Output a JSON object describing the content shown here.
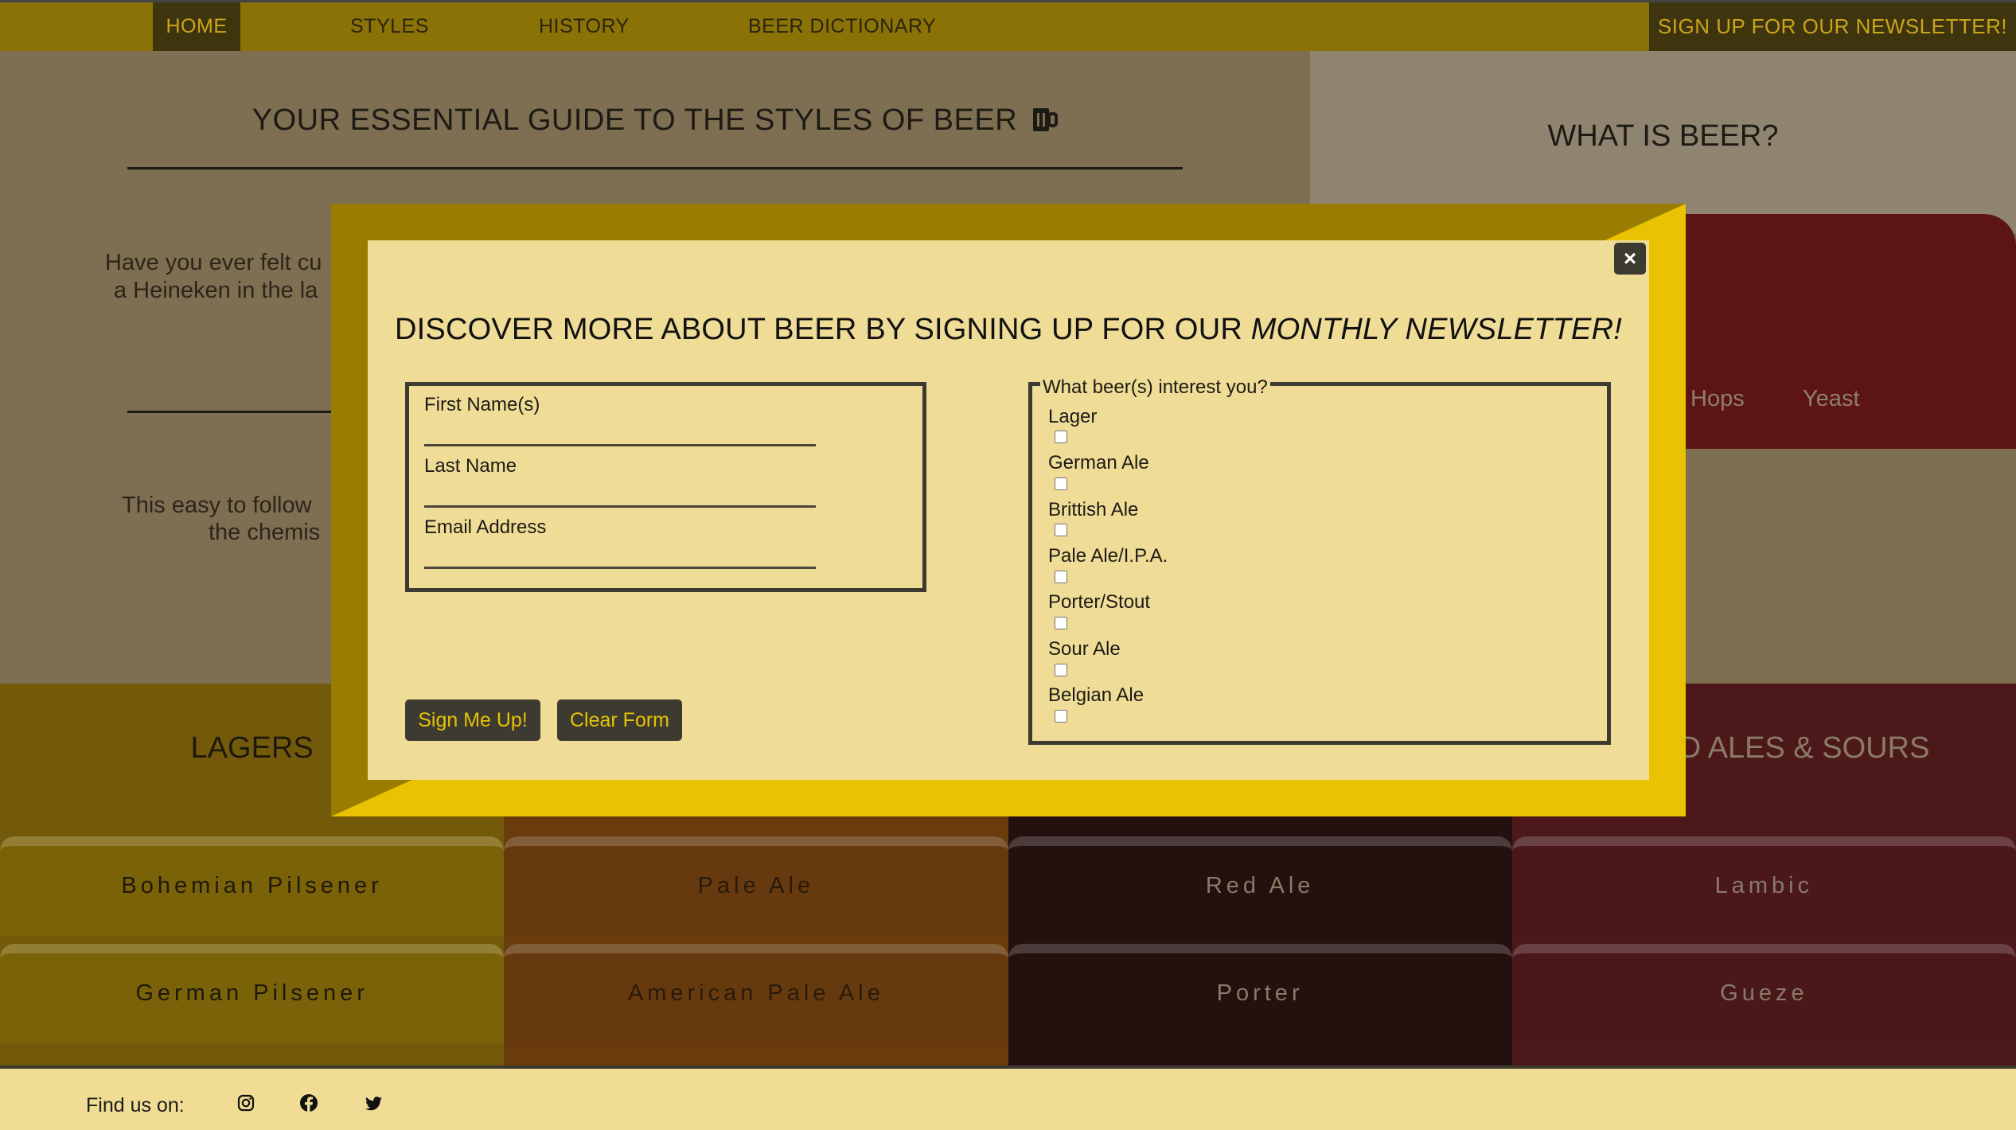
{
  "nav": {
    "items": [
      "HOME",
      "STYLES",
      "HISTORY",
      "BEER DICTIONARY"
    ],
    "cta": "SIGN UP FOR OUR NEWSLETTER!"
  },
  "hero": {
    "title": "YOUR ESSENTIAL GUIDE TO THE STYLES OF BEER",
    "title_icon": "beer-mug-icon",
    "para1_line1": "Have you ever felt cu",
    "para1_line2": "a Heineken in the la",
    "para2_line1": "This easy to follow",
    "para2_line2": "the chemis"
  },
  "what_is_beer": {
    "title": "WHAT IS BEER?",
    "ingredients": [
      "Hops",
      "Yeast"
    ]
  },
  "styles": {
    "columns": [
      {
        "title": "LAGERS",
        "color": "#735a0b",
        "tab_color": "#7a6208",
        "text_color": "#1e180d",
        "items": [
          "Bohemian Pilsener",
          "German Pilsener"
        ]
      },
      {
        "title": "",
        "color": "#6a3c0c",
        "tab_color": "#663a0e",
        "text_color": "#2a1a0a",
        "items": [
          "Pale Ale",
          "American Pale Ale"
        ]
      },
      {
        "title": "",
        "color": "#251010",
        "tab_color": "#251010",
        "text_color": "#8a7a66",
        "items": [
          "Red Ale",
          "Porter"
        ]
      },
      {
        "title": "D ALES & SOURS",
        "color": "#4d181a",
        "tab_color": "#4a181b",
        "text_color": "#8a7a66",
        "items": [
          "Lambic",
          "Gueze"
        ]
      }
    ]
  },
  "footer": {
    "find_label": "Find us on:",
    "social": [
      "instagram-icon",
      "facebook-icon",
      "twitter-icon"
    ]
  },
  "modal": {
    "title_plain": "DISCOVER MORE ABOUT BEER BY SIGNING UP FOR OUR ",
    "title_em": "MONTHLY NEWSLETTER!",
    "close": "×",
    "fields": [
      {
        "label": "First Name(s)",
        "value": ""
      },
      {
        "label": "Last Name",
        "value": ""
      },
      {
        "label": "Email Address",
        "value": ""
      }
    ],
    "legend": "What beer(s) interest you?",
    "beers": [
      "Lager",
      "German Ale",
      "Brittish Ale",
      "Pale Ale/I.P.A.",
      "Porter/Stout",
      "Sour Ale",
      "Belgian Ale"
    ],
    "submit": "Sign Me Up!",
    "clear": "Clear Form"
  }
}
